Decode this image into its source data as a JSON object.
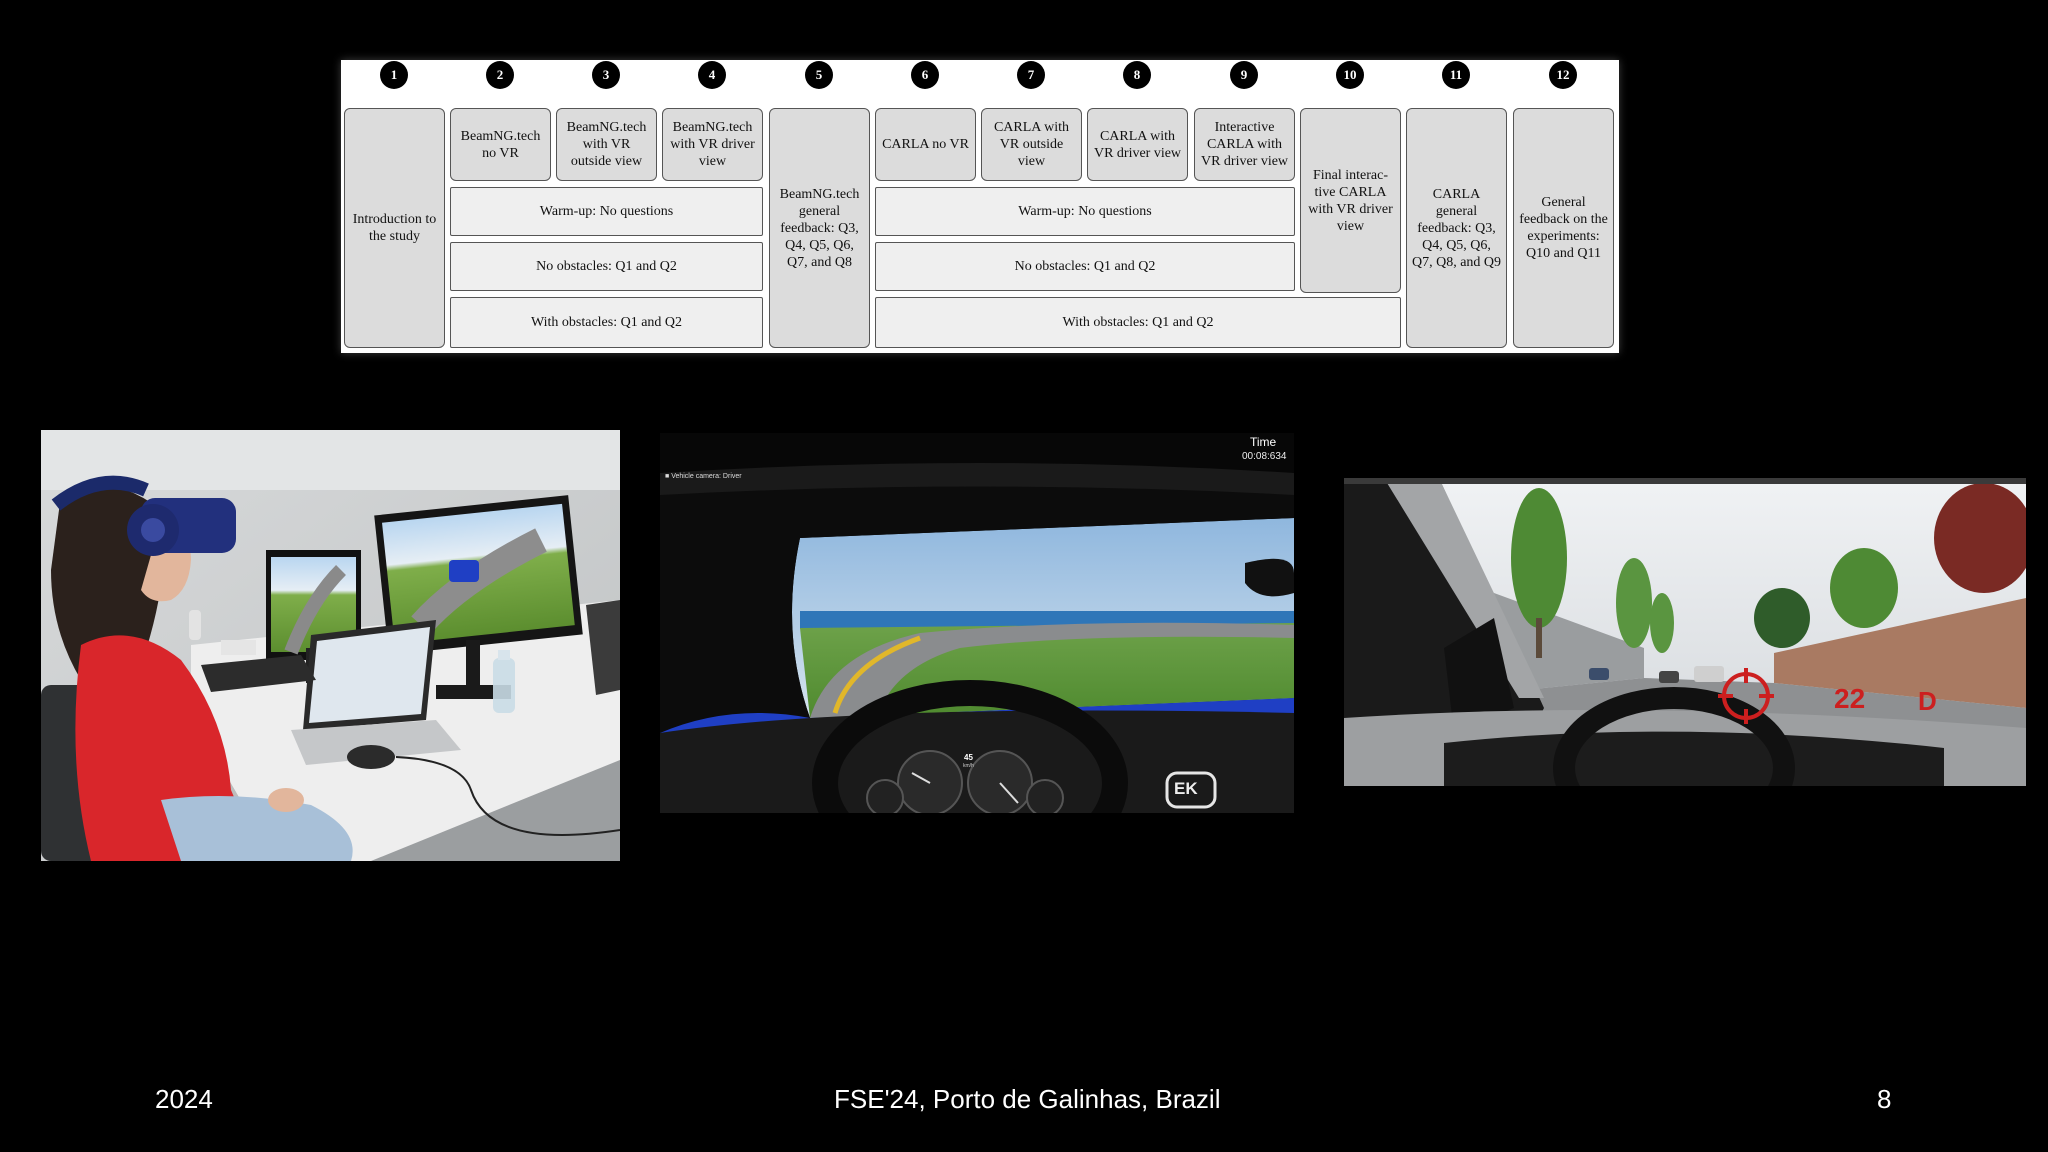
{
  "diagram": {
    "steps": [
      "1",
      "2",
      "3",
      "4",
      "5",
      "6",
      "7",
      "8",
      "9",
      "10",
      "11",
      "12"
    ],
    "introduction": "Introduction to the study",
    "beamng_no_vr": "BeamNG.tech no VR",
    "beamng_vr_outside": "BeamNG.tech with VR outside view",
    "beamng_vr_driver": "BeamNG.tech with VR driver view",
    "beamng_feedback": "BeamNG.tech general feedback: Q3, Q4, Q5, Q6, Q7, and Q8",
    "carla_no_vr": "CARLA no VR",
    "carla_vr_outside": "CARLA with VR outside view",
    "carla_vr_driver": "CARLA with VR driver view",
    "interactive_carla": "Interactive CARLA with VR driver view",
    "final_interactive": "Final interac-tive CARLA with VR driver view",
    "carla_feedback": "CARLA general feedback: Q3, Q4, Q5, Q6, Q7, Q8, and Q9",
    "general_feedback": "General feedback on the experiments: Q10 and Q11",
    "warmup": "Warm-up: No questions",
    "no_obstacles": "No obstacles: Q1 and Q2",
    "with_obstacles": "With obstacles: Q1 and Q2"
  },
  "video": {
    "time_label": "Time",
    "time_value": "00:08:634",
    "camera_label": "Vehicle camera: Driver",
    "speed": "45",
    "speed_unit": "km/h",
    "logo": "EK"
  },
  "carla_hud": {
    "speed": "22",
    "gear": "D"
  },
  "footer": {
    "year": "2024",
    "venue": "FSE'24, Porto de Galinhas, Brazil",
    "page": "8"
  },
  "colors": {
    "slide_background": "#000000",
    "diagram_box": "#dcdcdc",
    "hud_red": "#cc1f1f",
    "shirt_red": "#d9262b",
    "car_blue": "#1f3fc4"
  }
}
